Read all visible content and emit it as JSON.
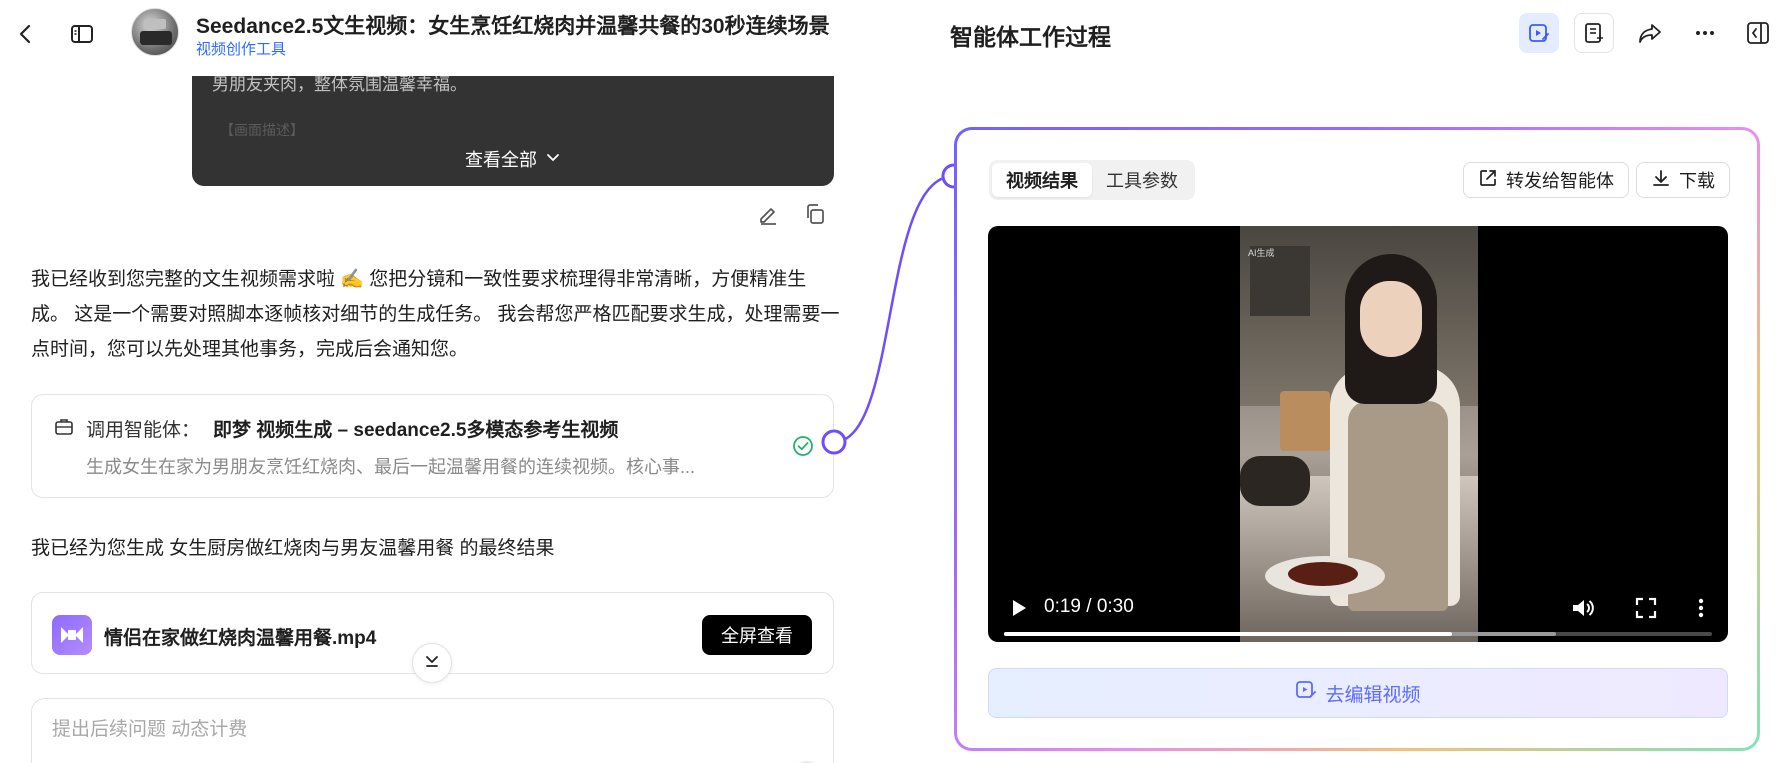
{
  "header": {
    "title": "Seedance2.5文生视频：女生烹饪红烧肉并温馨共餐的30秒连续场景",
    "subtitle": "视频创作工具"
  },
  "chat": {
    "prompt_card": {
      "preview_line": "男朋友夹肉，整体氛围温馨幸福。",
      "faded_line": "【画面描述】",
      "view_all_label": "查看全部"
    },
    "assistant_reply": "我已经收到您完整的文生视频需求啦 ✍️ 您把分镜和一致性要求梳理得非常清晰，方便精准生成。 这是一个需要对照脚本逐帧核对细节的生成任务。 我会帮您严格匹配要求生成，处理需要一点时间，您可以先处理其他事务，完成后会通知您。",
    "tool_call": {
      "label": "调用智能体：",
      "name": "即梦 视频生成 – seedance2.5多模态参考生视频",
      "description": "生成女生在家为男朋友烹饪红烧肉、最后一起温馨用餐的连续视频。核心事..."
    },
    "result_text": "我已经为您生成 女生厨房做红烧肉与男友温馨用餐 的最终结果",
    "file": {
      "name": "情侣在家做红烧肉温馨用餐.mp4",
      "action_label": "全屏查看"
    },
    "input": {
      "placeholder": "提出后续问题 动态计费",
      "value": ""
    }
  },
  "panel": {
    "title": "智能体工作过程",
    "tabs": [
      {
        "label": "视频结果",
        "active": true
      },
      {
        "label": "工具参数",
        "active": false
      }
    ],
    "forward_label": "转发给智能体",
    "download_label": "下载",
    "video": {
      "time_display": "0:19 / 0:30",
      "progress_fraction": 0.633,
      "buffered_fraction": 0.78,
      "watermark": "AI生成"
    },
    "edit_video_label": "去编辑视频"
  },
  "colors": {
    "accent": "#2f6bff",
    "success": "#22b36b",
    "connector": "#6f4dff",
    "edit_text": "#5b6cff"
  },
  "icons": [
    "back-icon",
    "sidebar-toggle-icon",
    "edit-icon",
    "copy-icon",
    "briefcase-icon",
    "check-circle-icon",
    "video-file-icon",
    "chevron-down-icon",
    "video-edit-icon",
    "note-icon",
    "share-icon",
    "more-icon",
    "collapse-panel-icon",
    "forward-icon",
    "download-icon",
    "play-icon",
    "volume-icon",
    "fullscreen-icon"
  ]
}
